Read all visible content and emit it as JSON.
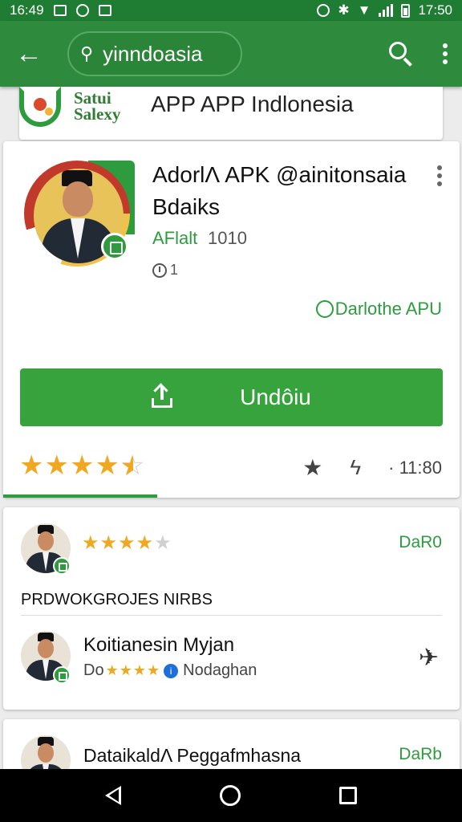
{
  "status_bar": {
    "time_left": "16:49",
    "time_right": "17:50"
  },
  "search": {
    "query": "yinndoasia"
  },
  "header_card": {
    "brand": "Satui Salexy",
    "title": "APP APP Indlonesia"
  },
  "app": {
    "name": "AdorlΛ APK @ainitonsaia Bdaiks",
    "developer": "AFlalt",
    "version": "1010",
    "meta_count": "1",
    "dev_link": "Darlothe APU",
    "install_label": "Undôiu",
    "rating_stars": 4.5,
    "stats_value": "· 11:80"
  },
  "review": {
    "stars": 4,
    "tag": "DaR0",
    "section_title": "PRDWOKGROJES NIRBS",
    "item_name": "Koitianesin Myjan",
    "item_sub_prefix": "Do",
    "item_sub_suffix": "Nodaghan",
    "item_stars": 4
  },
  "bottom_item": {
    "title": "DataikaldΛ Peggafmhasna",
    "tag": "DaRb"
  },
  "colors": {
    "primary_green": "#2e8b3e",
    "button_green": "#36a33d",
    "star_gold": "#f0a820"
  }
}
